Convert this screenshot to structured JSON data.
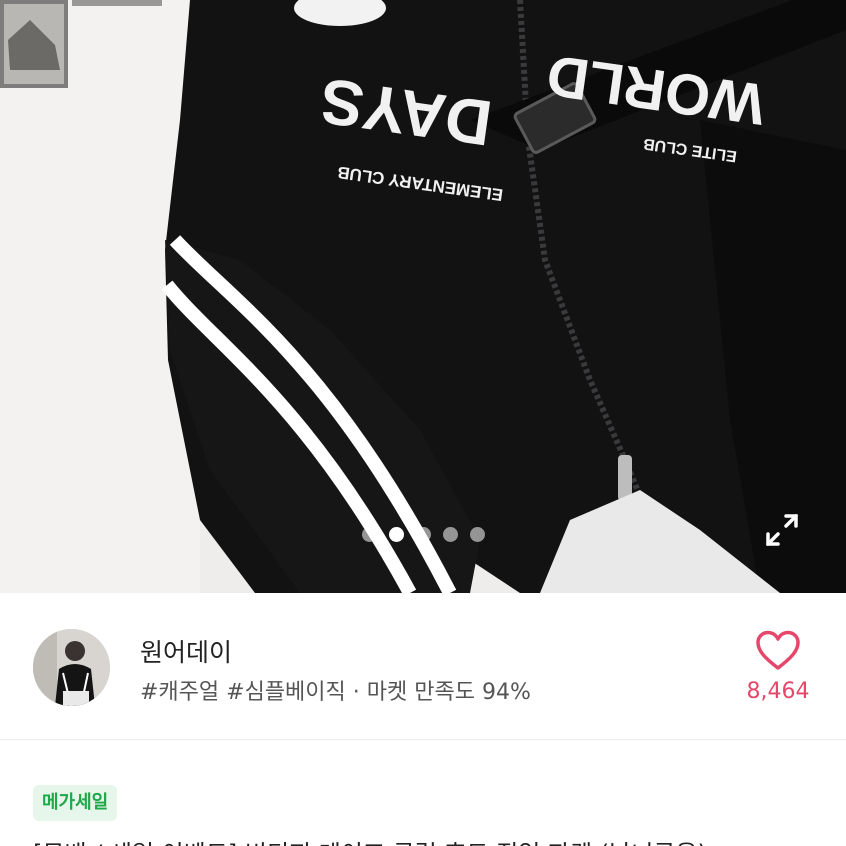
{
  "gallery": {
    "slide_count": 5,
    "active_index": 1,
    "expand_icon": "expand-icon",
    "print_text": "DAYS",
    "print_subtext": "ELEMENTARY CLUB",
    "print_text_right": "WORLD",
    "print_subtext_right": "ELITE CLUB"
  },
  "seller": {
    "name": "원어데이",
    "meta": "#캐주얼 #심플베이직 · 마켓 만족도 94%",
    "like_count": "8,464",
    "like_icon": "heart-outline-icon",
    "accent_color": "#e5476a"
  },
  "product": {
    "badge": "메가세일",
    "badge_color": "#1ea84a",
    "title": "[무배 / 세일 이벤트] 빈티지 데이즈 클럽 후드 집업 자켓 (남녀공용)"
  }
}
